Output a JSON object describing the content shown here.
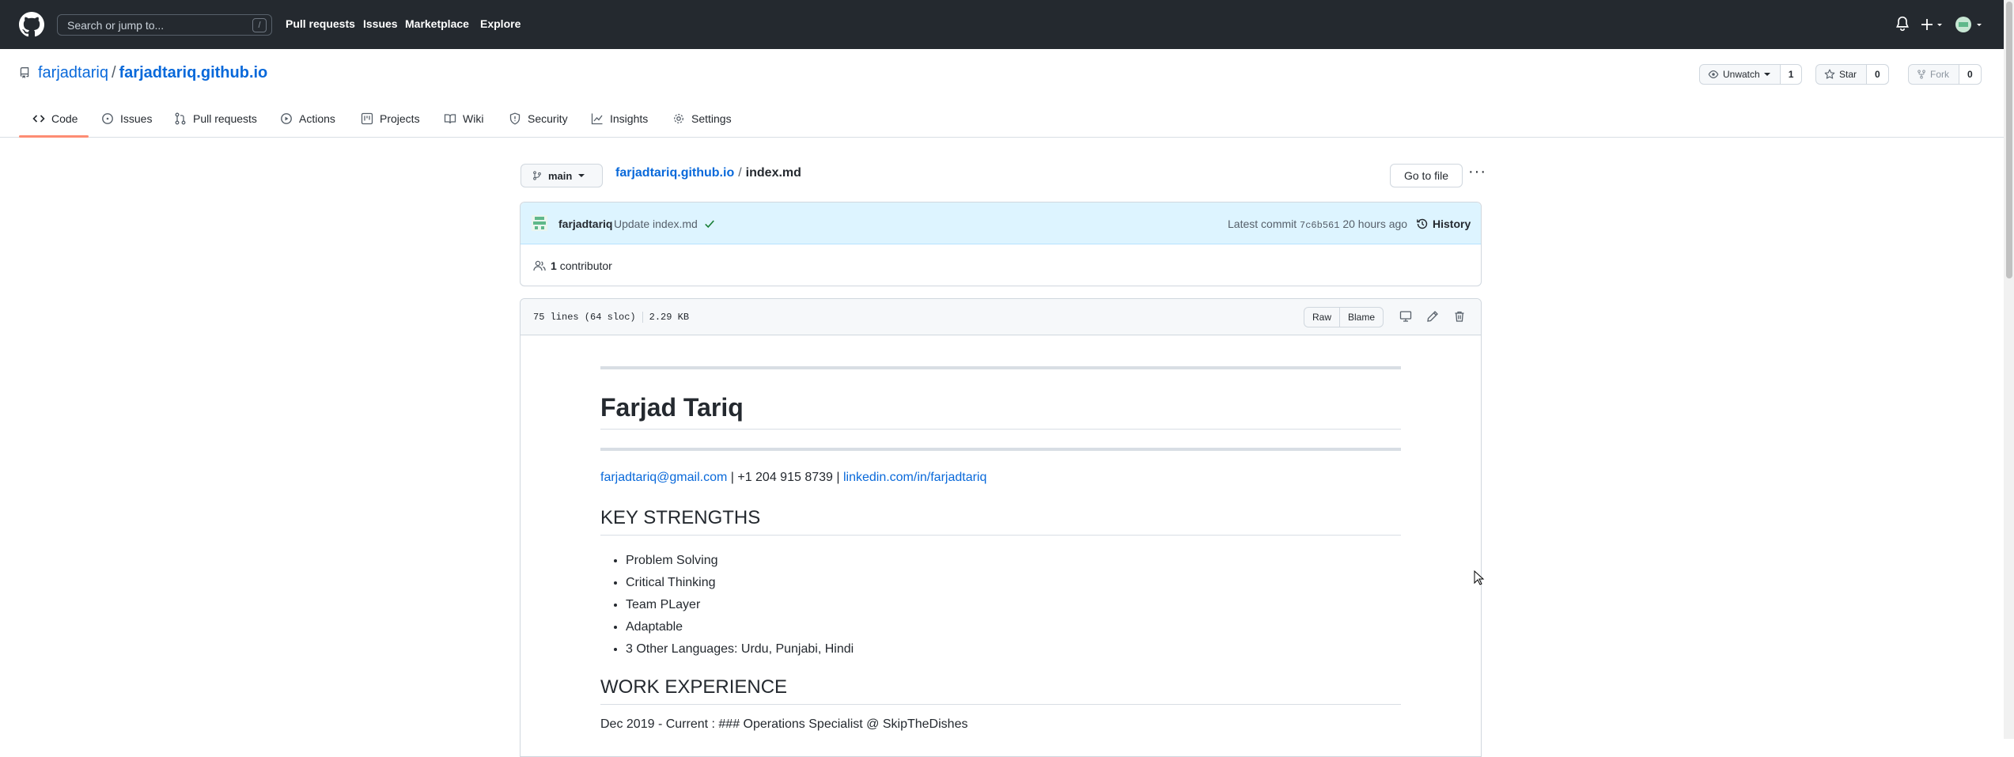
{
  "header": {
    "search_placeholder": "Search or jump to...",
    "search_shortcut": "/",
    "nav": [
      "Pull requests",
      "Issues",
      "Marketplace",
      "Explore"
    ],
    "icons": [
      "github-logo-icon",
      "bell-icon",
      "plus-icon",
      "avatar-icon"
    ]
  },
  "repo": {
    "owner": "farjadtariq",
    "separator": "/",
    "name": "farjadtariq.github.io",
    "watch_label": "Unwatch",
    "watch_count": "1",
    "star_label": "Star",
    "star_count": "0",
    "fork_label": "Fork",
    "fork_count": "0"
  },
  "tabs": [
    "Code",
    "Issues",
    "Pull requests",
    "Actions",
    "Projects",
    "Wiki",
    "Security",
    "Insights",
    "Settings"
  ],
  "file_nav": {
    "branch": "main",
    "breadcrumb_repo": "farjadtariq.github.io",
    "breadcrumb_sep": "/",
    "file_name": "index.md",
    "go_to_file": "Go to file",
    "more": "···"
  },
  "commit": {
    "author": "farjadtariq",
    "message": "Update index.md",
    "latest_label": "Latest commit",
    "sha": "7c6b561",
    "time": "20 hours ago",
    "history": "History",
    "contributors_count": "1",
    "contributors_label": "contributor"
  },
  "file": {
    "lines": "75 lines (64 sloc)",
    "size": "2.29 KB",
    "raw": "Raw",
    "blame": "Blame"
  },
  "markdown": {
    "title": "Farjad Tariq",
    "email": "farjadtariq@gmail.com",
    "phone": " | +1 204 915 8739 | ",
    "linkedin": "linkedin.com/in/farjadtariq",
    "strengths_heading": "KEY STRENGTHS",
    "strengths": [
      "Problem Solving",
      "Critical Thinking",
      "Team PLayer",
      "Adaptable",
      "3 Other Languages: Urdu, Punjabi, Hindi"
    ],
    "work_heading": "WORK EXPERIENCE",
    "work_line": "Dec 2019 - Current : ### Operations Specialist @ SkipTheDishes"
  }
}
